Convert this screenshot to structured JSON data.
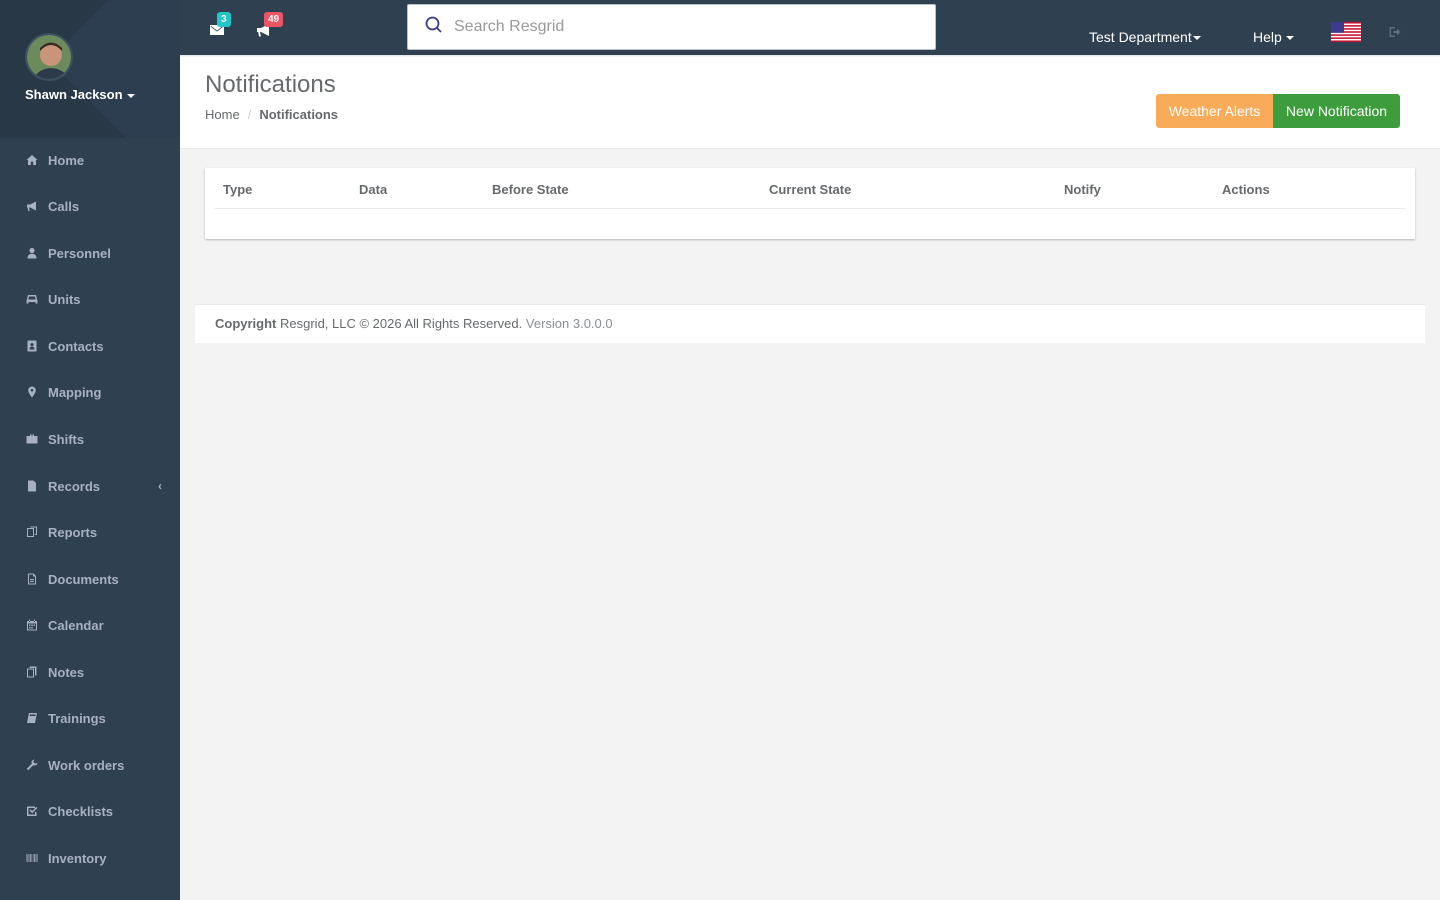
{
  "user": {
    "name": "Shawn Jackson"
  },
  "sidebar": {
    "items": [
      {
        "label": "Home",
        "icon": "home-icon"
      },
      {
        "label": "Calls",
        "icon": "bullhorn-icon"
      },
      {
        "label": "Personnel",
        "icon": "user-icon"
      },
      {
        "label": "Units",
        "icon": "truck-icon"
      },
      {
        "label": "Contacts",
        "icon": "contact-card-icon"
      },
      {
        "label": "Mapping",
        "icon": "map-marker-icon"
      },
      {
        "label": "Shifts",
        "icon": "briefcase-icon"
      },
      {
        "label": "Records",
        "icon": "file-icon",
        "chevron": "‹"
      },
      {
        "label": "Reports",
        "icon": "report-icon"
      },
      {
        "label": "Documents",
        "icon": "document-icon"
      },
      {
        "label": "Calendar",
        "icon": "calendar-icon"
      },
      {
        "label": "Notes",
        "icon": "notes-icon"
      },
      {
        "label": "Trainings",
        "icon": "book-icon"
      },
      {
        "label": "Work orders",
        "icon": "wrench-icon"
      },
      {
        "label": "Checklists",
        "icon": "checkbox-icon"
      },
      {
        "label": "Inventory",
        "icon": "barcode-icon"
      }
    ]
  },
  "topbar": {
    "messages_count": "3",
    "calls_count": "49",
    "search_placeholder": "Search Resgrid",
    "department": "Test Department",
    "help": "Help"
  },
  "page": {
    "title": "Notifications",
    "breadcrumb": [
      "Home",
      "Notifications"
    ],
    "buttons": {
      "weather": "Weather Alerts",
      "new": "New Notification"
    }
  },
  "table": {
    "columns": [
      "Type",
      "Data",
      "Before State",
      "Current State",
      "Notify",
      "Actions"
    ],
    "rows": []
  },
  "footer": {
    "copyright_label": "Copyright",
    "copyright_text": " Resgrid, LLC © 2026 All Rights Reserved.",
    "version": "Version 3.0.0.0"
  },
  "colors": {
    "sidebar": "#2f4050",
    "weather_button": "#f8ac59",
    "new_button": "#3d9c3b",
    "badge_teal": "#23c6c8",
    "badge_red": "#ed5565"
  }
}
